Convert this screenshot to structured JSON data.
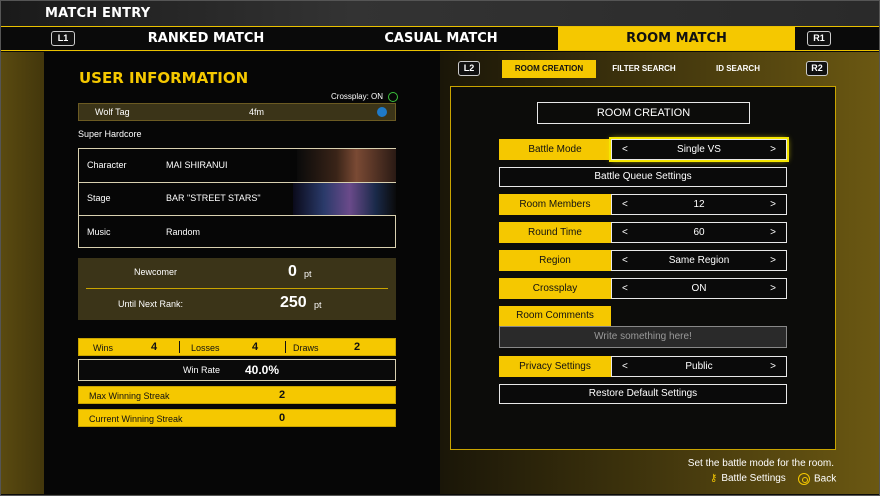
{
  "header": {
    "title": "MATCH ENTRY",
    "l1": "L1",
    "r1": "R1",
    "tabs": [
      "RANKED MATCH",
      "CASUAL MATCH",
      "ROOM MATCH"
    ]
  },
  "user": {
    "section_title": "USER INFORMATION",
    "crossplay": "Crossplay: ON",
    "tag_label": "Wolf Tag",
    "tag_value": "4fm",
    "rank_title": "Super Hardcore",
    "character_label": "Character",
    "character_value": "MAI SHIRANUI",
    "stage_label": "Stage",
    "stage_value": "BAR \"STREET STARS\"",
    "music_label": "Music",
    "music_value": "Random",
    "rank_name": "Newcomer",
    "points": "0",
    "pt": "pt",
    "next_label": "Until Next Rank:",
    "next_value": "250",
    "pt2": "pt",
    "wins_label": "Wins",
    "wins": "4",
    "losses_label": "Losses",
    "losses": "4",
    "draws_label": "Draws",
    "draws": "2",
    "winrate_label": "Win Rate",
    "winrate": "40.0%",
    "max_streak_label": "Max Winning Streak",
    "max_streak": "2",
    "cur_streak_label": "Current Winning Streak",
    "cur_streak": "0"
  },
  "room": {
    "l2": "L2",
    "r2": "R2",
    "subtabs": [
      "ROOM CREATION",
      "FILTER SEARCH",
      "ID SEARCH"
    ],
    "title": "ROOM CREATION",
    "battle_mode_label": "Battle Mode",
    "battle_mode": "Single VS",
    "queue_settings": "Battle Queue Settings",
    "members_label": "Room Members",
    "members": "12",
    "round_time_label": "Round Time",
    "round_time": "60",
    "region_label": "Region",
    "region": "Same Region",
    "crossplay_label": "Crossplay",
    "crossplay": "ON",
    "comments_label": "Room Comments",
    "comments_placeholder": "Write something here!",
    "privacy_label": "Privacy Settings",
    "privacy": "Public",
    "restore": "Restore Default Settings",
    "arrow_left": "<",
    "arrow_right": ">"
  },
  "footer": {
    "hint": "Set the battle mode for the room.",
    "battle_settings": "Battle Settings",
    "back": "Back"
  },
  "colors": {
    "accent": "#f5c800",
    "panel_bg": "#0a0a0a"
  }
}
